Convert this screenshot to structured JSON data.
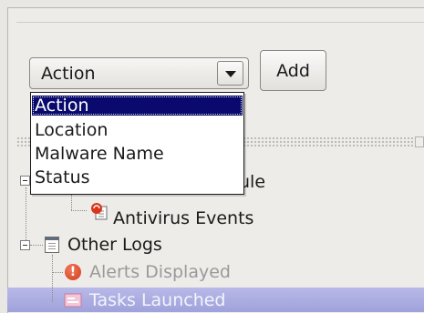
{
  "filter": {
    "combo_value": "Action",
    "add_label": "Add",
    "options": [
      "Action",
      "Location",
      "Malware Name",
      "Status"
    ],
    "selected_index": 0
  },
  "tree": {
    "partial_module_label": "ule",
    "antivirus_events": "Antivirus Events",
    "other_logs": "Other Logs",
    "alerts_displayed": "Alerts Displayed",
    "tasks_launched": "Tasks Launched"
  },
  "colors": {
    "selection": "#0a0a6e",
    "disabled_text": "#9a9a9a",
    "row_highlight": "#a9abe0"
  },
  "icons": [
    "dropdown-arrow-icon",
    "log-document-icon",
    "antivirus-event-icon",
    "alert-icon",
    "task-icon"
  ]
}
